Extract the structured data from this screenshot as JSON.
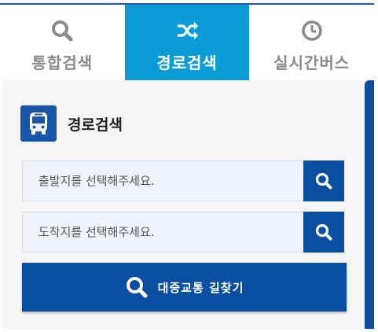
{
  "tabs": [
    {
      "label": "통합검색",
      "icon": "search-icon",
      "active": false
    },
    {
      "label": "경로검색",
      "icon": "shuffle-icon",
      "active": true
    },
    {
      "label": "실시간버스",
      "icon": "clock-icon",
      "active": false
    }
  ],
  "route_search": {
    "title": "경로검색",
    "icon": "bus-icon",
    "origin_placeholder": "출발지를 선택해주세요.",
    "destination_placeholder": "도착지를 선택해주세요.",
    "submit_label": "대중교통 길찾기"
  },
  "colors": {
    "active_tab": "#0b9bd6",
    "primary": "#0a4ea2",
    "inactive_tab_text": "#8a8a8a",
    "panel_bg": "#f6f6f6",
    "input_bg": "#eef3fb"
  }
}
